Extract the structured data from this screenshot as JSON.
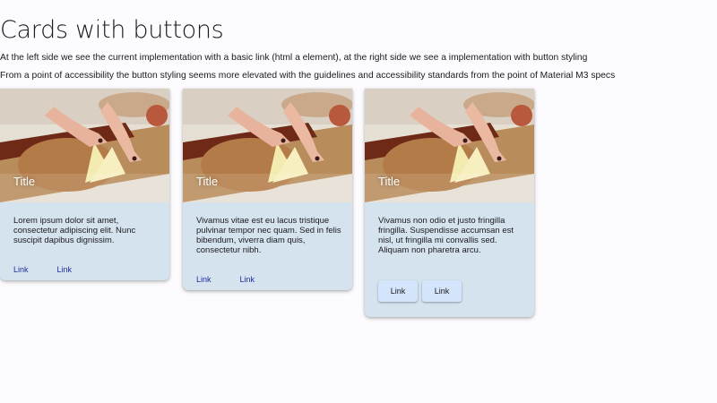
{
  "page": {
    "title": "Cards with buttons",
    "description_1": "At the left side we see the current implementation with a basic link (html a element), at the right side we see a implementation with button styling",
    "description_2": "From a point of accessibility the button styling seems more elevated with the guidelines and accessibility standards from the point of Material M3 specs"
  },
  "cards": [
    {
      "title": "Title",
      "text": "Lorem ipsum dolor sit amet, consectetur adipiscing elit. Nunc suscipit dapibus dignissim.",
      "actions": [
        "Link",
        "Link"
      ],
      "action_style": "link"
    },
    {
      "title": "Title",
      "text": "Vivamus vitae est eu lacus tristique pulvinar tempor nec quam. Sed in felis bibendum, viverra diam quis, consectetur nibh.",
      "actions": [
        "Link",
        "Link"
      ],
      "action_style": "link"
    },
    {
      "title": "Title",
      "text": "Vivamus non odio et justo fringilla fringilla. Suspendisse accumsan est nisl, ut fringilla mi convallis sed. Aliquam non pharetra arcu.",
      "actions": [
        "Link",
        "Link"
      ],
      "action_style": "button"
    }
  ],
  "colors": {
    "page_background": "#fcfbfe",
    "card_background": "#d5e3ef",
    "link_color": "#1e2d9d",
    "button_background": "#d4e4fa"
  }
}
